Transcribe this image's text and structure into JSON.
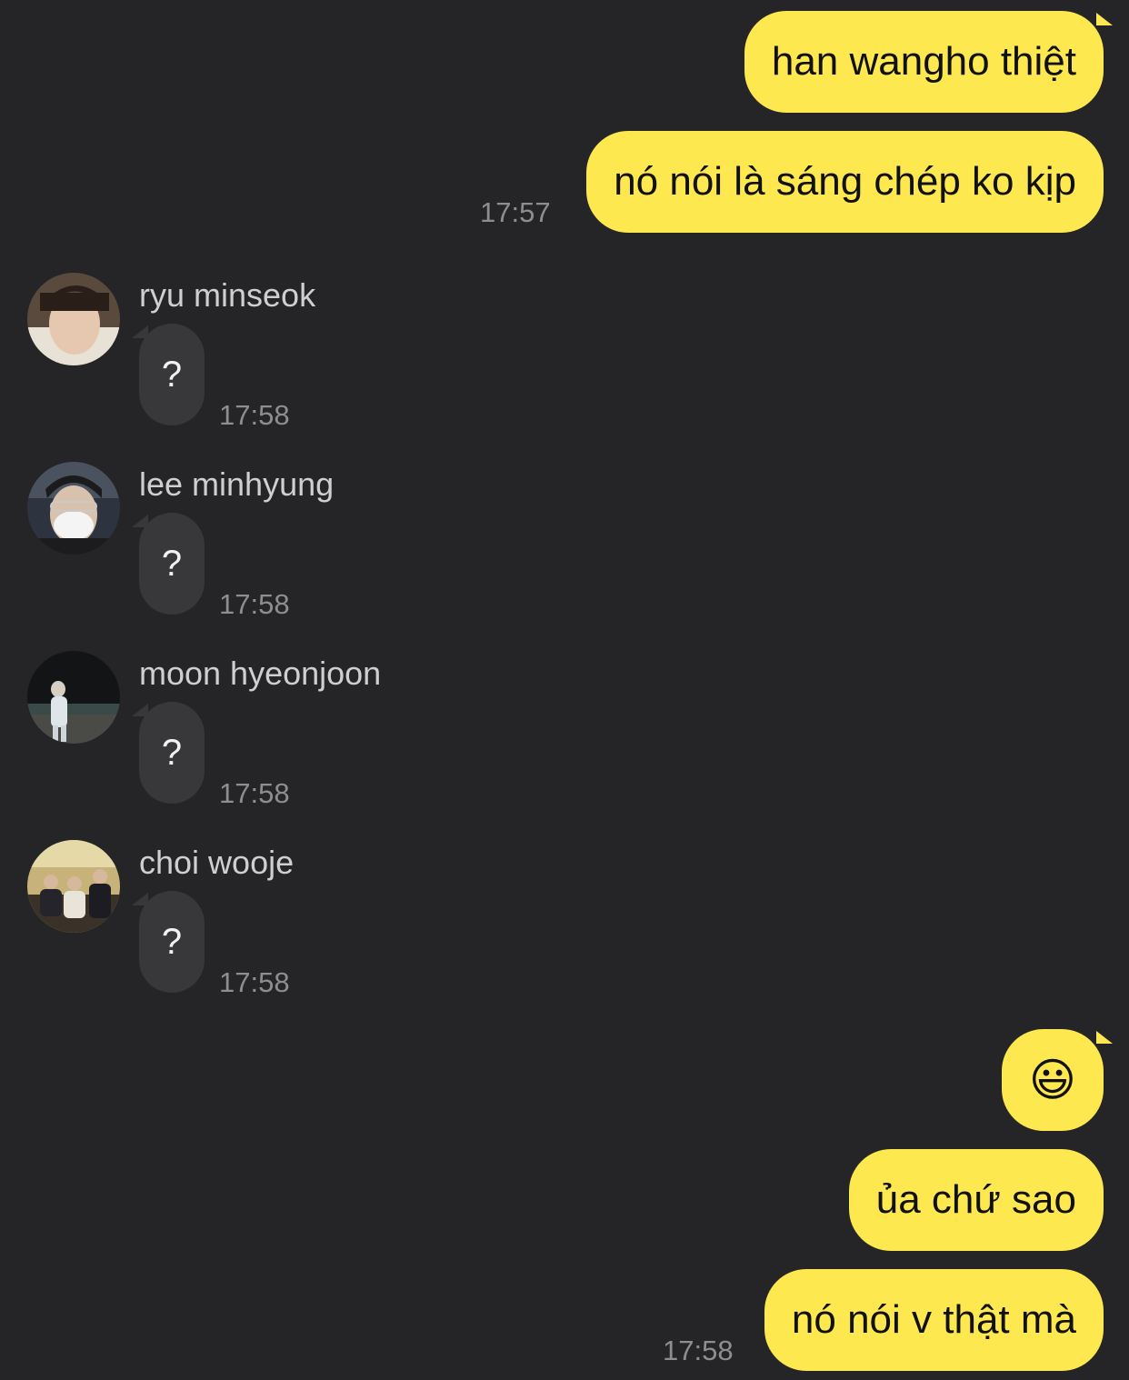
{
  "colors": {
    "background": "#252527",
    "outgoing_bubble": "#FEE84F",
    "incoming_bubble": "#38383b",
    "timestamp": "#8e8e90"
  },
  "messages_top": {
    "m1": "han wangho thiệt",
    "m2": "nó nói là sáng chép ko kịp",
    "time": "17:57"
  },
  "incoming": [
    {
      "sender": "ryu minseok",
      "text": "?",
      "time": "17:58"
    },
    {
      "sender": "lee minhyung",
      "text": "?",
      "time": "17:58"
    },
    {
      "sender": "moon hyeonjoon",
      "text": "?",
      "time": "17:58"
    },
    {
      "sender": "choi wooje",
      "text": "?",
      "time": "17:58"
    }
  ],
  "messages_bottom": {
    "m1": "😃",
    "m2": "ủa chứ sao",
    "m3": "nó nói v thật mà",
    "time": "17:58"
  }
}
